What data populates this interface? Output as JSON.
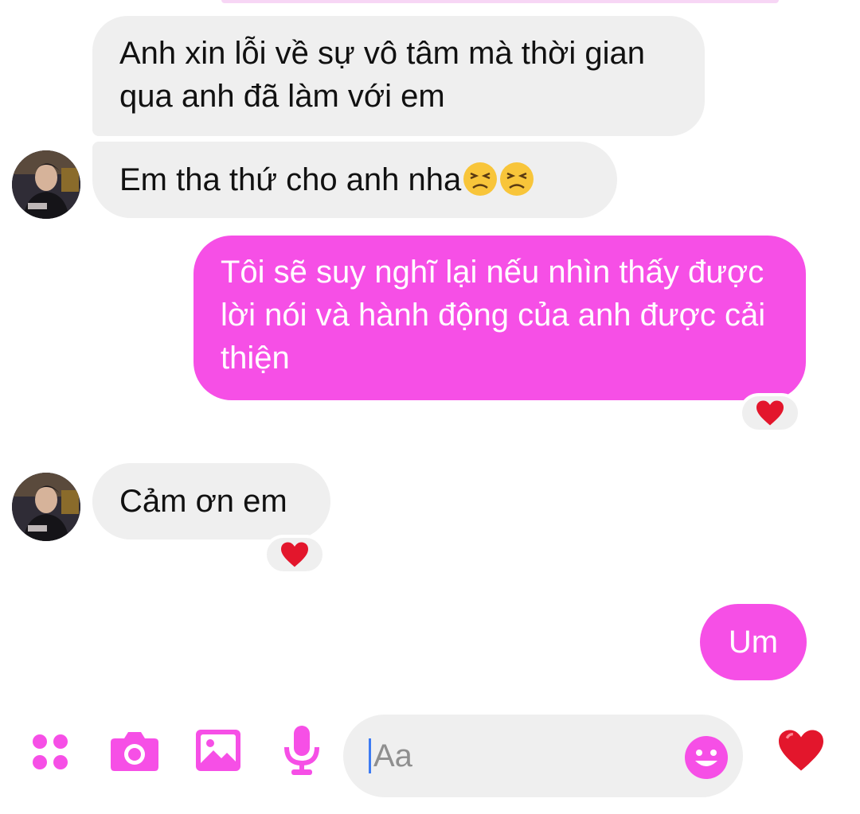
{
  "messages": [
    {
      "sender": "contact",
      "text": "Anh xin lỗi về sự vô tâm mà thời gian qua anh đã làm với em"
    },
    {
      "sender": "contact",
      "text": "Em tha thứ cho anh nha",
      "emoji": [
        "persevering-face",
        "persevering-face"
      ]
    },
    {
      "sender": "me",
      "text": "Tôi sẽ suy nghĩ lại nếu nhìn thấy được lời nói và hành động của anh được cải thiện",
      "reaction": "red-heart"
    },
    {
      "sender": "contact",
      "text": "Cảm ơn em",
      "reaction": "red-heart"
    },
    {
      "sender": "me",
      "text": "Um"
    }
  ],
  "composer": {
    "placeholder": "Aa",
    "icons": [
      "apps-icon",
      "camera-icon",
      "gallery-icon",
      "microphone-icon",
      "emoji-icon",
      "like-heart-icon"
    ]
  },
  "colors": {
    "accent": "#f64fe6",
    "incoming_bubble": "#efefef",
    "heart": "#e3162c",
    "caret": "#3d7bf3"
  }
}
